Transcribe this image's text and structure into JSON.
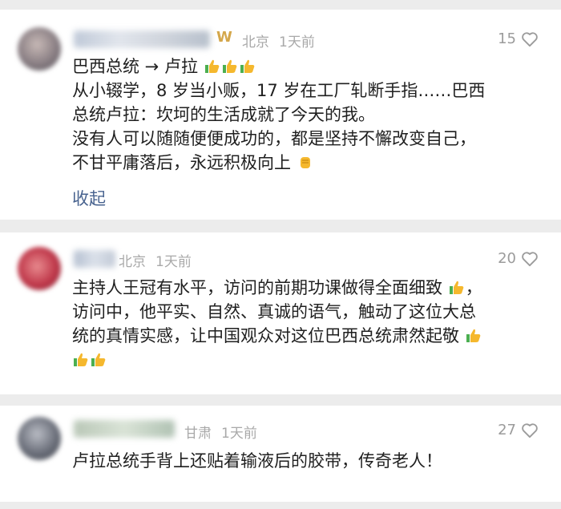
{
  "comments": [
    {
      "badge": "W",
      "location": "北京",
      "time": "1天前",
      "likes": "15",
      "title": "巴西总统 → 卢拉",
      "body": [
        "从小辍学，8 岁当小贩，17 岁在工厂轧断手指……巴西",
        "总统卢拉：坎坷的生活成就了今天的我。",
        "没有人可以随随便便成功的，都是坚持不懈改变自己，",
        "不甘平庸落后，永远积极向上"
      ],
      "fold_label": "收起",
      "avatar_color": "#8a7f84"
    },
    {
      "location": "北京",
      "time": "1天前",
      "likes": "20",
      "body": [
        "主持人王冠有水平，访问的前期功课做得全面细致",
        "访问中，他平实、自然、真诚的语气，触动了这位大总",
        "统的真情实感，让中国观众对这位巴西总统肃然起敬"
      ],
      "avatar_color": "#c0394b"
    },
    {
      "location": "甘肃",
      "time": "1天前",
      "likes": "27",
      "body": [
        "卢拉总统手背上还贴着输液后的胶带，传奇老人！"
      ],
      "avatar_color": "#6b6f7a"
    }
  ],
  "icons": {
    "like": "heart-outline-icon",
    "thumbs": "thumbs-up-emoji",
    "fist": "raised-fist-emoji"
  },
  "colors": {
    "meta_gray": "#a9a9a9",
    "link_blue": "#48638f",
    "vip_gold": "#d4a74b"
  }
}
